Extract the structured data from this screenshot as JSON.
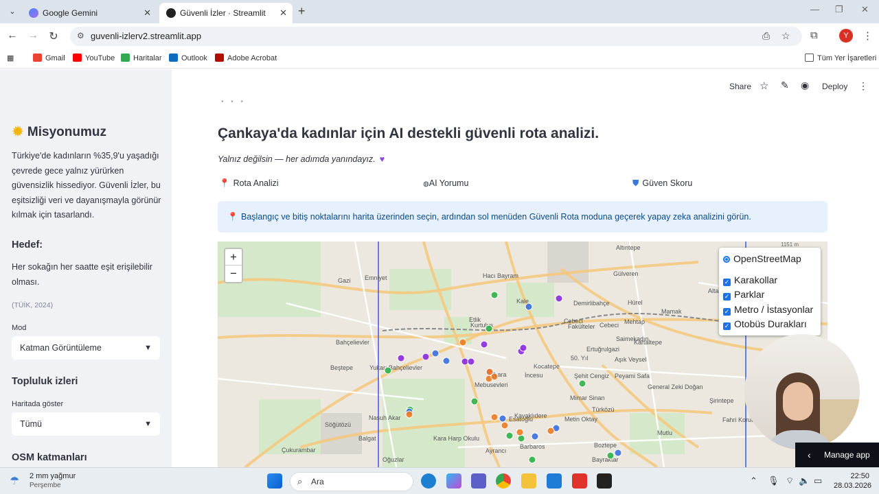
{
  "browser": {
    "tabs": [
      {
        "title": "Google Gemini"
      },
      {
        "title": "Güvenli İzler · Streamlit"
      }
    ],
    "url": "guvenli-izlerv2.streamlit.app",
    "profile_initial": "Y",
    "bookmarks": [
      "Gmail",
      "YouTube",
      "Haritalar",
      "Outlook",
      "Adobe Acrobat"
    ],
    "all_bookmarks": "Tüm Yer İşaretleri"
  },
  "sidebar": {
    "mission_title": "Misyonumuz",
    "mission_text": "Türkiye'de kadınların %35,9'u yaşadığı çevrede gece yalnız yürürken güvensizlik hissediyor. Güvenli İzler, bu eşitsizliği veri ve dayanışmayla görünür kılmak için tasarlandı.",
    "goal_title": "Hedef:",
    "goal_text": "Her sokağın her saatte eşit erişilebilir olması.",
    "source": "(TÜİK, 2024)",
    "mode_label": "Mod",
    "mode_value": "Katman Görüntüleme",
    "community_title": "Topluluk izleri",
    "show_label": "Haritada göster",
    "show_value": "Tümü",
    "osm_title": "OSM katmanları"
  },
  "header": {
    "share": "Share",
    "deploy": "Deploy"
  },
  "main": {
    "title": "Çankaya'da kadınlar için AI destekli güvenli rota analizi.",
    "tagline": "Yalnız değilsin — her adımda yanındayız.",
    "features": [
      "Rota Analizi",
      "AI Yorumu",
      "Güven Skoru"
    ],
    "info": "Başlangıç ve bitiş noktalarını harita üzerinden seçin, ardından sol menüden Güvenli Rota moduna geçerek yapay zeka analizini görün."
  },
  "map": {
    "zoom_in": "+",
    "zoom_out": "−",
    "base_layer": "OpenStreetMap",
    "overlays": [
      "Karakollar",
      "Parklar",
      "Metro / İstasyonlar",
      "Otobüs Durakları"
    ],
    "place_labels": [
      "Gazi",
      "Emniyet",
      "Hacı Bayram",
      "Gülveren",
      "Bahçelievler",
      "Beştepe",
      "Kocatepe",
      "Ankara",
      "İncesu",
      "Kurtuluş",
      "Cebeci",
      "Fakülteler",
      "Mamak",
      "Söğütözü",
      "Nasuh Akar",
      "Balgat",
      "Mebusevleri",
      "Kavaklıdere",
      "Esatoğlu",
      "Metin Oktay",
      "Türközü",
      "Barbaros",
      "Bayraktar",
      "Boztepe",
      "Çukurambar",
      "Ayrancı",
      "Oğuzlar",
      "Şirintepe",
      "Fahri Korutürk",
      "Altaağaç",
      "Hürel",
      "Peyami Safa",
      "Şehit Cengiz",
      "Mimar Sinan",
      "General Zeki Doğan",
      "Saimekadın",
      "Kartaltepe",
      "Mutlu",
      "Demirlibahçe",
      "Cebeci",
      "50. Yıl",
      "Aşık Veysel",
      "Ertuğrulgazi",
      "Altıntepe",
      "Kale",
      "Etlik",
      "Mehtap",
      "Yukarı Bahçelievler",
      "Kara Harp Okulu"
    ],
    "scale_text": "1151 m",
    "point_colors": {
      "karakol": "#8a2be2",
      "park": "#2fb34a",
      "metro": "#3a6fe0",
      "bus": "#f07c20"
    }
  },
  "floating": {
    "manage_app": "Manage app"
  },
  "taskbar": {
    "weather_temp": "2 mm yağmur",
    "weather_day": "Perşembe",
    "search_placeholder": "Ara",
    "time": "22:50",
    "date": "28.03.2026"
  }
}
